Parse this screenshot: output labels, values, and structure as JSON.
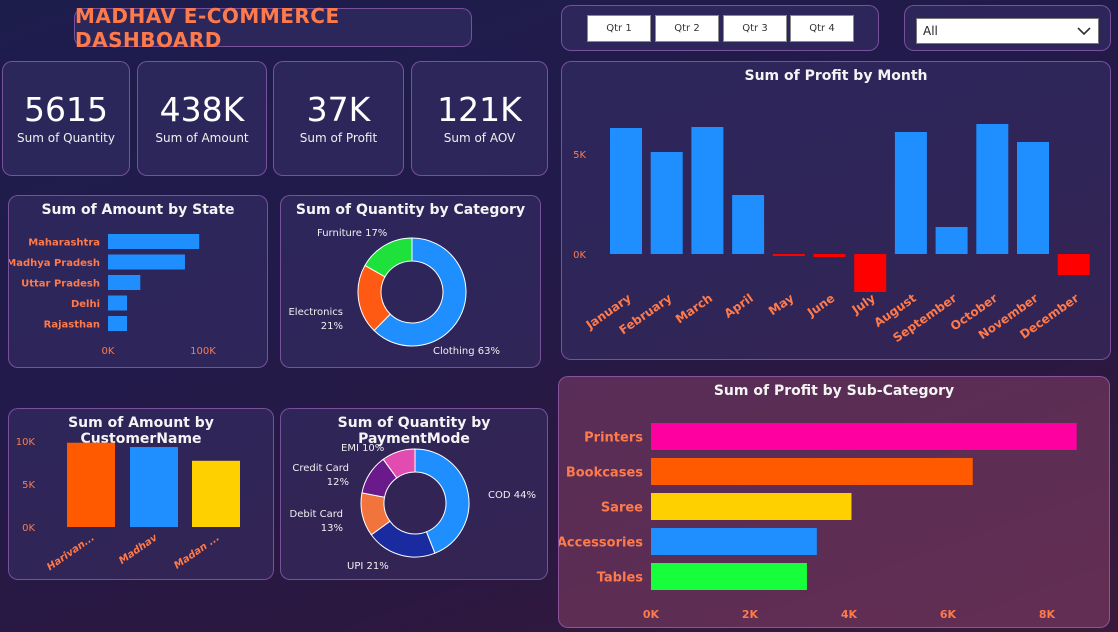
{
  "header": {
    "title": "MADHAV E-COMMERCE DASHBOARD"
  },
  "quarters": [
    "Qtr 1",
    "Qtr 2",
    "Qtr 3",
    "Qtr 4"
  ],
  "filter": {
    "selected": "All"
  },
  "kpis": [
    {
      "value": "5615",
      "label": "Sum of Quantity"
    },
    {
      "value": "438K",
      "label": "Sum of Amount"
    },
    {
      "value": "37K",
      "label": "Sum of Profit"
    },
    {
      "value": "121K",
      "label": "Sum of AOV"
    }
  ],
  "chart_data": [
    {
      "id": "state",
      "type": "bar",
      "orientation": "horizontal",
      "title": "Sum of Amount by State",
      "categories": [
        "Maharashtra",
        "Madhya Pradesh",
        "Uttar Pradesh",
        "Delhi",
        "Rajasthan"
      ],
      "values": [
        96000,
        81000,
        34000,
        20000,
        20000
      ],
      "xticks": [
        "0K",
        "100K"
      ],
      "xlim": [
        0,
        100000
      ],
      "color": "#1f8fff"
    },
    {
      "id": "category",
      "type": "pie",
      "title": "Sum of Quantity by Category",
      "labels": [
        "Clothing",
        "Electronics",
        "Furniture"
      ],
      "values": [
        63,
        21,
        17
      ],
      "display": [
        "Clothing 63%",
        "Electronics",
        "21%",
        "Furniture 17%"
      ],
      "colors": [
        "#1f8fff",
        "#ff5a14",
        "#1ee13c"
      ]
    },
    {
      "id": "customer",
      "type": "bar",
      "title": "Sum of Amount by CustomerName",
      "categories": [
        "Harivan...",
        "Madhav",
        "Madan ..."
      ],
      "values": [
        9800,
        9300,
        7700
      ],
      "yticks": [
        "10K",
        "5K",
        "0K"
      ],
      "ylim": [
        0,
        10000
      ],
      "colors": [
        "#ff5a00",
        "#1f8fff",
        "#ffd000"
      ]
    },
    {
      "id": "payment",
      "type": "pie",
      "title": "Sum of Quantity by PaymentMode",
      "labels": [
        "COD",
        "UPI",
        "Debit Card",
        "Credit Card",
        "EMI"
      ],
      "values": [
        44,
        21,
        13,
        12,
        10
      ],
      "display": [
        "COD 44%",
        "UPI 21%",
        "Debit Card",
        "13%",
        "Credit Card",
        "12%",
        "EMI 10%"
      ],
      "colors": [
        "#1f8fff",
        "#1a2ba0",
        "#f0743c",
        "#6a1a8a",
        "#e24bb0"
      ]
    },
    {
      "id": "month",
      "type": "bar",
      "title": "Sum of Profit by Month",
      "categories": [
        "January",
        "February",
        "March",
        "April",
        "May",
        "June",
        "July",
        "August",
        "September",
        "October",
        "November",
        "December"
      ],
      "values": [
        6300,
        5100,
        6350,
        2950,
        -100,
        -150,
        -1900,
        6100,
        1350,
        6500,
        5600,
        -1050
      ],
      "yticks": [
        "5K",
        "0K"
      ],
      "pos_color": "#1f8fff",
      "neg_color": "#ff0000"
    },
    {
      "id": "subcat",
      "type": "bar",
      "orientation": "horizontal",
      "title": "Sum of Profit by Sub-Category",
      "categories": [
        "Printers",
        "Bookcases",
        "Saree",
        "Accessories",
        "Tables"
      ],
      "values": [
        8600,
        6500,
        4050,
        3350,
        3150
      ],
      "xticks": [
        "0K",
        "2K",
        "4K",
        "6K",
        "8K"
      ],
      "xlim": [
        0,
        8000
      ],
      "colors": [
        "#ff00a0",
        "#ff5a00",
        "#ffd000",
        "#1f8fff",
        "#17ff3a"
      ]
    }
  ]
}
